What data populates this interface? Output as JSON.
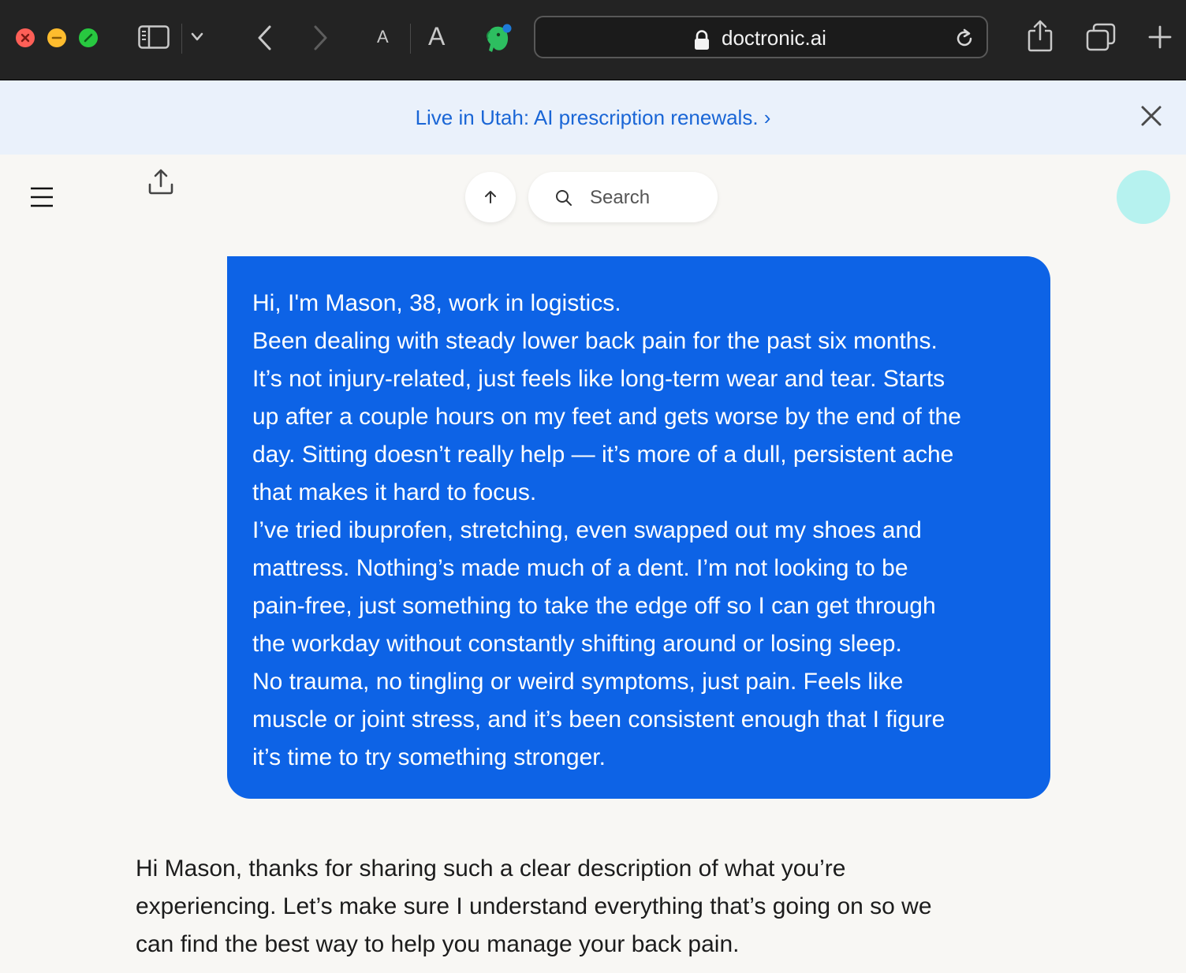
{
  "browser": {
    "url": "doctronic.ai",
    "font_small_label": "A",
    "font_large_label": "A"
  },
  "banner": {
    "text": "Live in Utah: AI prescription renewals. ›"
  },
  "header": {
    "search_placeholder": "Search"
  },
  "conversation": {
    "user_message_lines": [
      "Hi, I'm Mason, 38, work in logistics.",
      "Been dealing with steady lower back pain for the past six months.",
      "It’s not injury-related, just feels like long-term wear and tear. Starts",
      "up after a couple hours on my feet and gets worse by the end of the",
      "day. Sitting doesn’t really help — it’s more of a dull, persistent ache",
      "that makes it hard to focus.",
      "I’ve tried ibuprofen, stretching, even swapped out my shoes and",
      "mattress. Nothing’s made much of a dent. I’m not looking to be",
      "pain-free, just something to take the edge off so I can get through",
      "the workday without constantly shifting around or losing sleep.",
      "No trauma, no tingling or weird symptoms, just pain. Feels like",
      "muscle or joint stress, and it’s been consistent enough that I figure",
      "it’s time to try something stronger."
    ],
    "assistant_message_lines": [
      "Hi Mason, thanks for sharing such a clear description of what you’re",
      "experiencing. Let’s make sure I understand everything that’s going on so we",
      "can find the best way to help you manage your back pain."
    ]
  },
  "colors": {
    "user_bubble": "#0d63e6",
    "banner_background": "#eaf1fb",
    "banner_link": "#1a66d6",
    "avatar": "#b6f2ef",
    "page_background": "#f8f7f4"
  }
}
